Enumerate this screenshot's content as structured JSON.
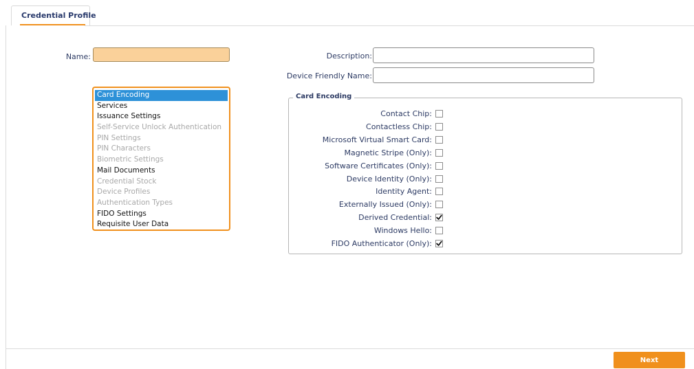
{
  "tabs": [
    {
      "label": "Credential Profile",
      "active": true
    }
  ],
  "form": {
    "name_label": "Name:",
    "name_value": "",
    "description_label": "Description:",
    "description_value": "",
    "friendly_name_label": "Device Friendly Name:",
    "friendly_name_value": ""
  },
  "sections": [
    {
      "label": "Card Encoding",
      "state": "selected"
    },
    {
      "label": "Services",
      "state": "enabled"
    },
    {
      "label": "Issuance Settings",
      "state": "enabled"
    },
    {
      "label": "Self-Service Unlock Authentication",
      "state": "disabled"
    },
    {
      "label": "PIN Settings",
      "state": "disabled"
    },
    {
      "label": "PIN Characters",
      "state": "disabled"
    },
    {
      "label": "Biometric Settings",
      "state": "disabled"
    },
    {
      "label": "Mail Documents",
      "state": "enabled"
    },
    {
      "label": "Credential Stock",
      "state": "disabled"
    },
    {
      "label": "Device Profiles",
      "state": "disabled"
    },
    {
      "label": "Authentication Types",
      "state": "disabled"
    },
    {
      "label": "FIDO Settings",
      "state": "enabled"
    },
    {
      "label": "Requisite User Data",
      "state": "enabled"
    }
  ],
  "card_encoding": {
    "legend": "Card Encoding",
    "options": [
      {
        "label": "Contact Chip:",
        "checked": false
      },
      {
        "label": "Contactless Chip:",
        "checked": false
      },
      {
        "label": "Microsoft Virtual Smart Card:",
        "checked": false
      },
      {
        "label": "Magnetic Stripe (Only):",
        "checked": false
      },
      {
        "label": "Software Certificates (Only):",
        "checked": false
      },
      {
        "label": "Device Identity (Only):",
        "checked": false
      },
      {
        "label": "Identity Agent:",
        "checked": false
      },
      {
        "label": "Externally Issued (Only):",
        "checked": false
      },
      {
        "label": "Derived Credential:",
        "checked": true
      },
      {
        "label": "Windows Hello:",
        "checked": false
      },
      {
        "label": "FIDO Authenticator (Only):",
        "checked": true
      }
    ]
  },
  "footer": {
    "next_label": "Next"
  },
  "colors": {
    "accent": "#f0901c",
    "selection": "#2d91d8",
    "label_text": "#2c3a63",
    "required_field": "#fad19a",
    "disabled_text": "#a8a8a8"
  }
}
